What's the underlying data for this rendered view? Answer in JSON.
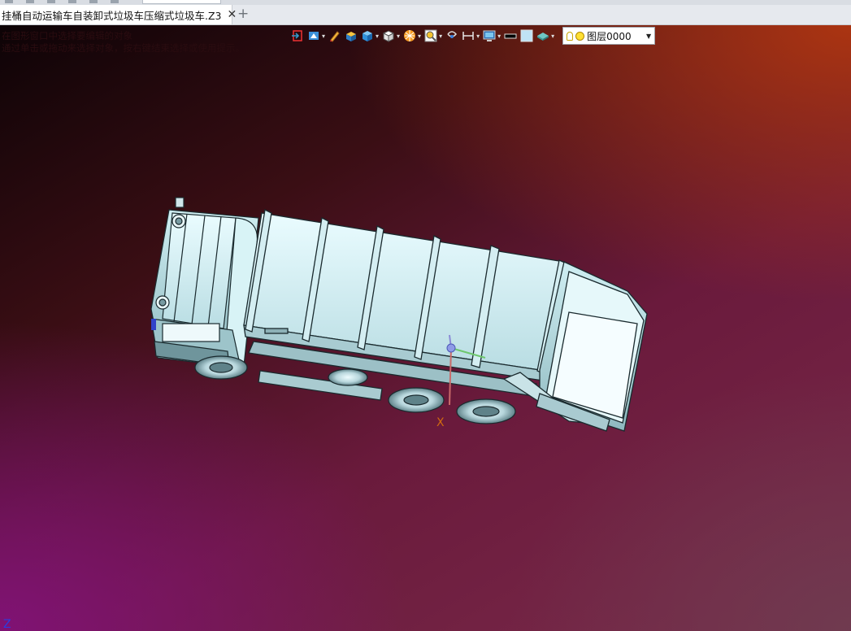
{
  "tabs": [
    {
      "title": "挂桶自动运输车自装卸式垃圾车压缩式垃圾车.Z3",
      "close_glyph": "✕"
    }
  ],
  "new_tab_glyph": "+",
  "viewport": {
    "hint_lines": [
      "在图形窗口中选择要编辑的对象",
      "通过单击或拖动来选择对象，按右键结束选择或使用提示。"
    ],
    "axis_labels": {
      "x": "X",
      "z": "Z"
    },
    "background_colors": [
      "#0d0306",
      "#b03610",
      "#821278",
      "#6e3c50"
    ]
  },
  "toolbar": {
    "buttons": [
      {
        "icon": "exit-view-icon",
        "dropdown": false
      },
      {
        "icon": "display-mode-icon",
        "dropdown": true
      },
      {
        "icon": "pencil-icon",
        "dropdown": false
      },
      {
        "icon": "shaded-solid-icon",
        "dropdown": false
      },
      {
        "icon": "solid-box-icon",
        "dropdown": true
      },
      {
        "icon": "view-cube-icon",
        "dropdown": true
      },
      {
        "icon": "render-ball-icon",
        "dropdown": true
      },
      {
        "icon": "zoom-fit-icon",
        "dropdown": true
      },
      {
        "icon": "snap-icon",
        "dropdown": false
      },
      {
        "icon": "dimension-icon",
        "dropdown": true
      },
      {
        "icon": "screen-display-icon",
        "dropdown": true
      },
      {
        "icon": "line-color-icon",
        "dropdown": false
      },
      {
        "icon": "face-color-icon",
        "dropdown": false
      },
      {
        "icon": "material-icon",
        "dropdown": true
      }
    ],
    "layer": {
      "label": "图层0000",
      "arrow": "▼"
    }
  }
}
